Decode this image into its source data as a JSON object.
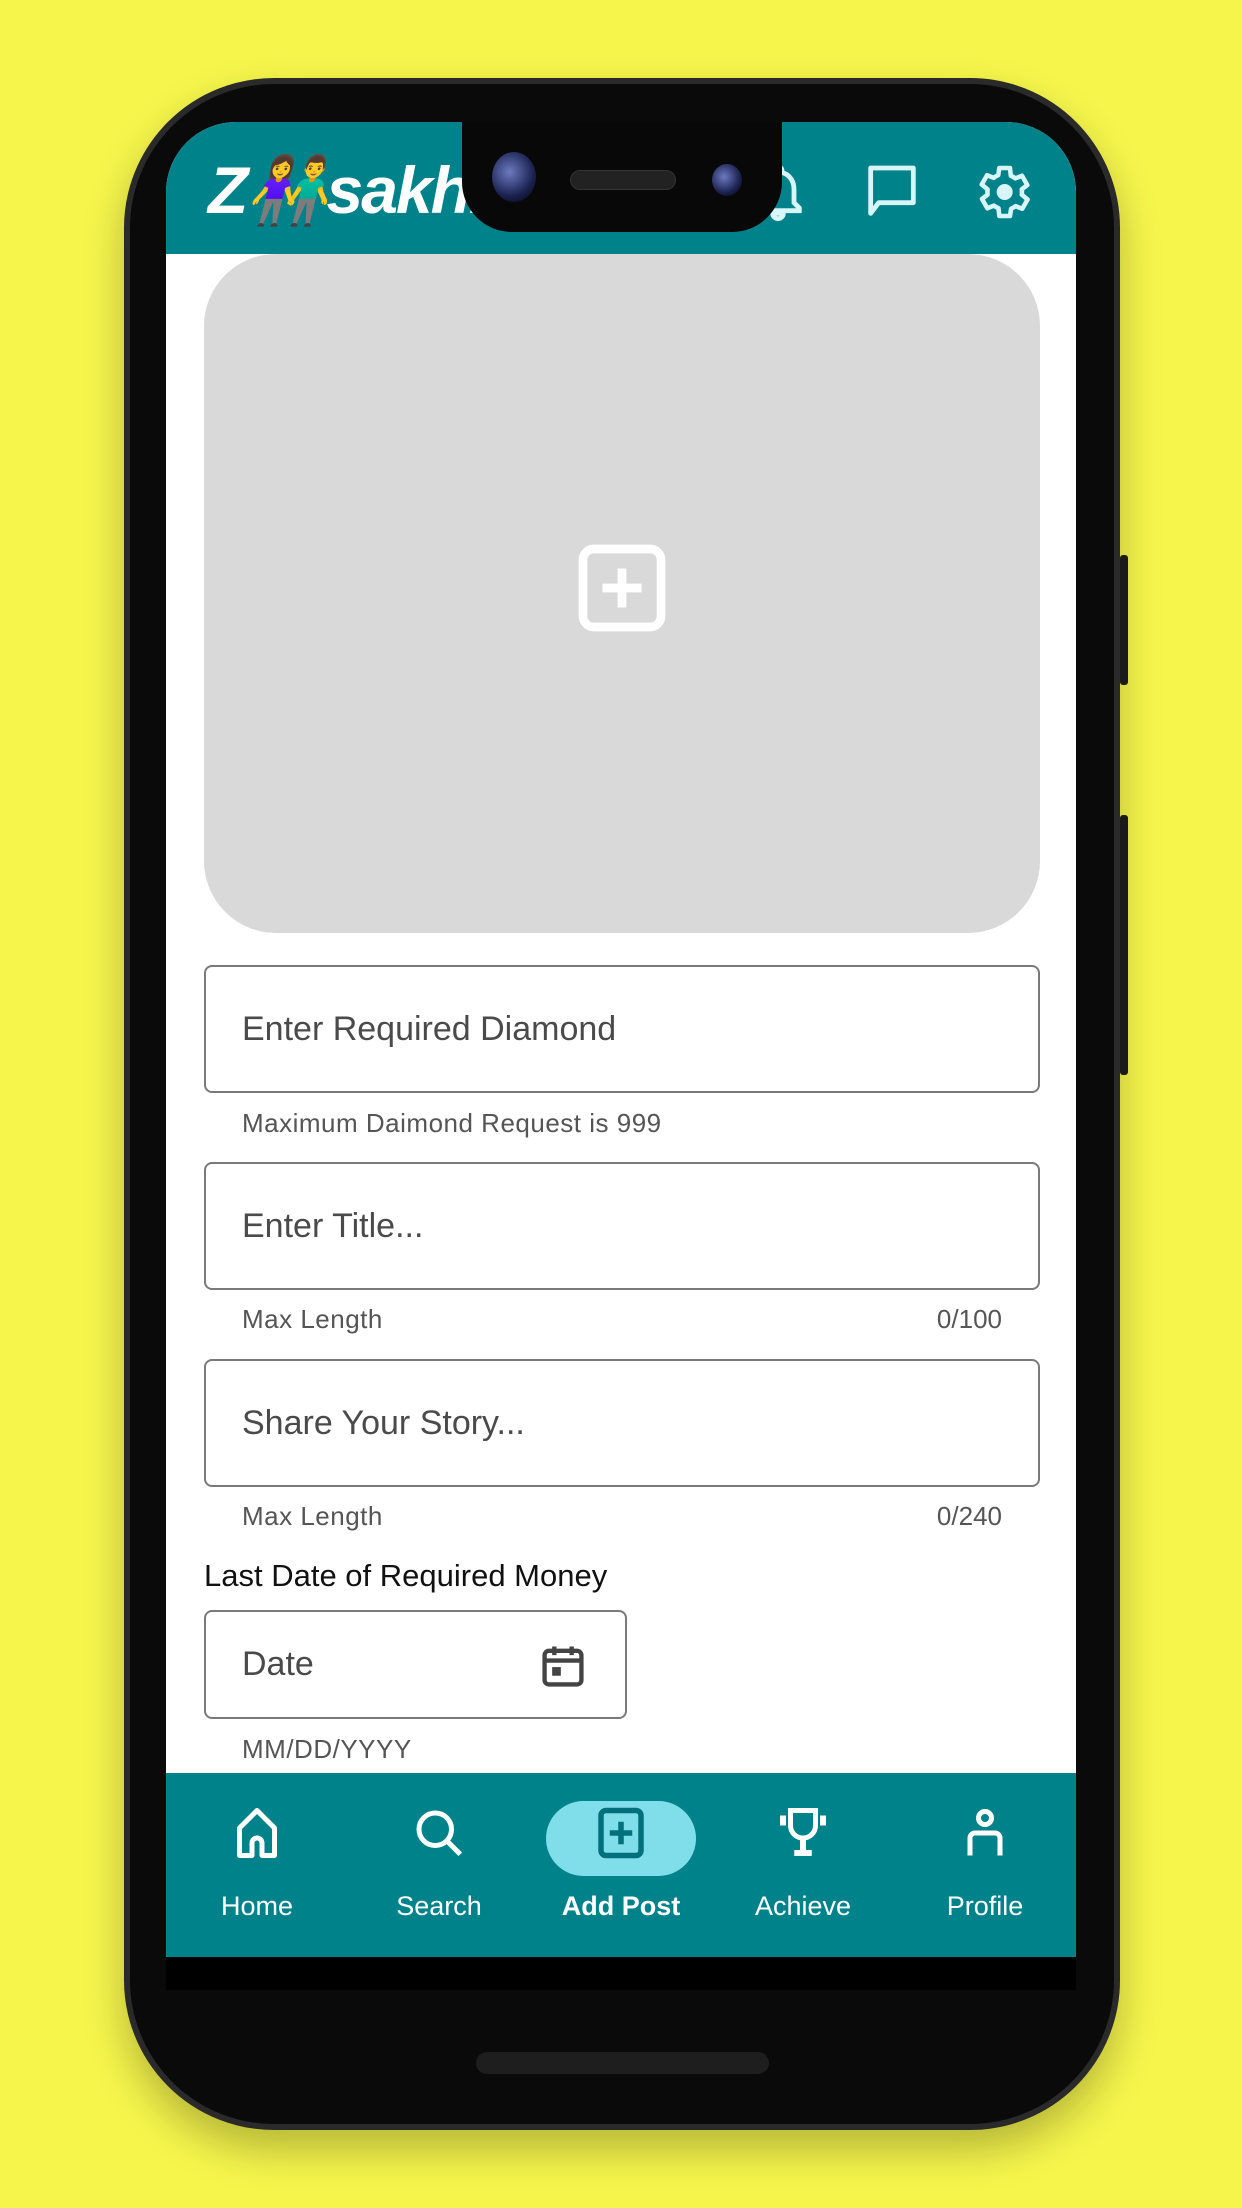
{
  "app": {
    "logo_text": "Zisakhi",
    "logo_prefix": "Z",
    "logo_suffix": "sakhi"
  },
  "header": {
    "icons": [
      "bell-icon",
      "chat-icon",
      "gear-icon"
    ]
  },
  "upload": {
    "icon": "add-box-icon"
  },
  "form": {
    "diamond": {
      "placeholder": "Enter Required Diamond",
      "helper": "Maximum Daimond Request is 999"
    },
    "title": {
      "placeholder": "Enter Title...",
      "helper": "Max Length",
      "counter": "0/100"
    },
    "story": {
      "placeholder": "Share Your Story...",
      "helper": "Max Length",
      "counter": "0/240"
    },
    "date": {
      "label": "Last Date of Required Money",
      "placeholder": "Date",
      "helper": "MM/DD/YYYY",
      "icon": "calendar-icon"
    }
  },
  "nav": {
    "items": [
      {
        "label": "Home",
        "icon": "home-icon"
      },
      {
        "label": "Search",
        "icon": "search-icon"
      },
      {
        "label": "Add Post",
        "icon": "add-box-icon",
        "active": true
      },
      {
        "label": "Achieve",
        "icon": "trophy-icon"
      },
      {
        "label": "Profile",
        "icon": "person-icon"
      }
    ]
  },
  "colors": {
    "primary": "#00828b",
    "active_pill": "#7fdeea",
    "background": "#f5f54c",
    "placeholder_bg": "#d9d9d9",
    "logo_accent": "#e91e9c"
  }
}
